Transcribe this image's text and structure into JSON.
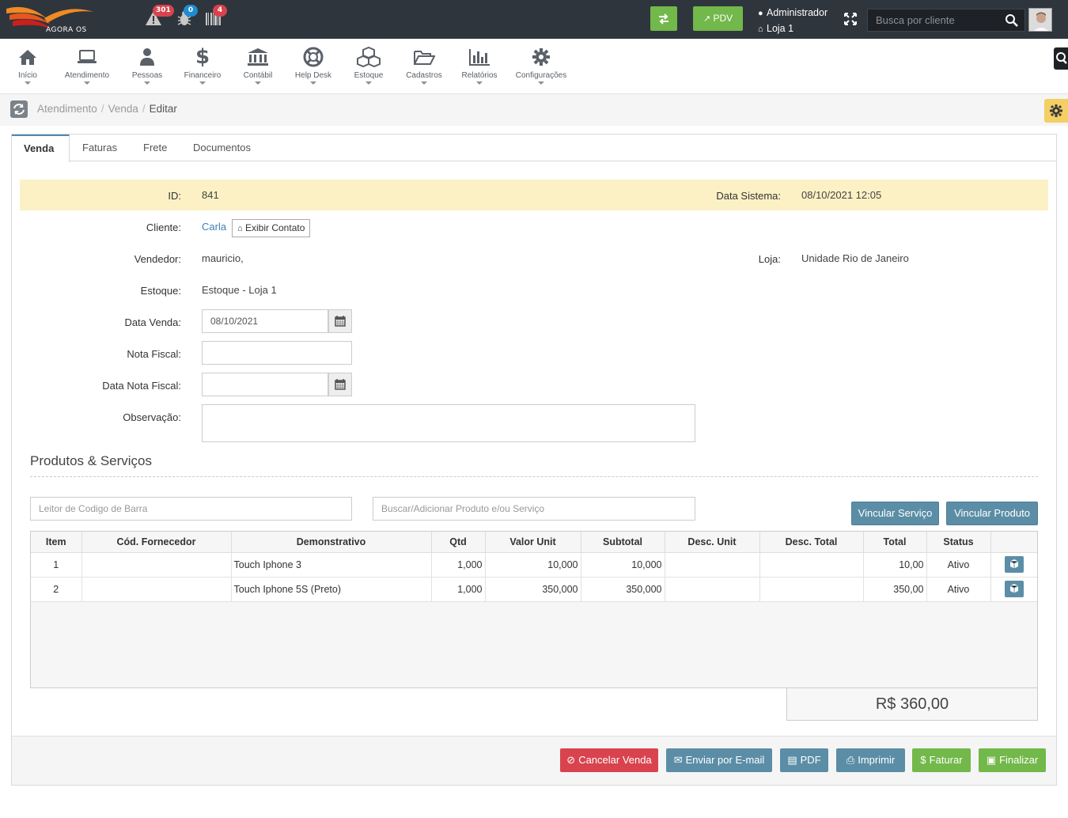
{
  "topbar": {
    "logo_text": "AGORA OS",
    "notifications": [
      {
        "icon": "warning-icon",
        "count": "301",
        "color": "#d9434e"
      },
      {
        "icon": "bug-icon",
        "count": "0",
        "color": "#1f8bd2"
      },
      {
        "icon": "barcode-icon",
        "count": "4",
        "color": "#d9434e"
      }
    ],
    "pdv_label": "PDV",
    "user_name": "Administrador",
    "store": "Loja 1",
    "search_placeholder": "Busca por cliente",
    "accent_green": "#72b84a"
  },
  "nav": [
    {
      "label": "Início",
      "icon": "home-icon"
    },
    {
      "label": "Atendimento",
      "icon": "laptop-icon"
    },
    {
      "label": "Pessoas",
      "icon": "user-icon"
    },
    {
      "label": "Financeiro",
      "icon": "dollar-icon"
    },
    {
      "label": "Contábil",
      "icon": "bank-icon"
    },
    {
      "label": "Help Desk",
      "icon": "lifebuoy-icon"
    },
    {
      "label": "Estoque",
      "icon": "cubes-icon"
    },
    {
      "label": "Cadastros",
      "icon": "folder-icon"
    },
    {
      "label": "Relatórios",
      "icon": "bar-chart-icon"
    },
    {
      "label": "Configurações",
      "icon": "gear-icon"
    }
  ],
  "breadcrumb": [
    "Atendimento",
    "Venda",
    "Editar"
  ],
  "tabs": [
    "Venda",
    "Faturas",
    "Frete",
    "Documentos"
  ],
  "form": {
    "id_label": "ID:",
    "id_value": "841",
    "data_sistema_label": "Data Sistema:",
    "data_sistema_value": "08/10/2021 12:05",
    "cliente_label": "Cliente:",
    "cliente_value": "Carla",
    "exibir_contato": "Exibir Contato",
    "vendedor_label": "Vendedor:",
    "vendedor_value": "mauricio,",
    "loja_label": "Loja:",
    "loja_value": "Unidade Rio de Janeiro",
    "estoque_label": "Estoque:",
    "estoque_value": "Estoque - Loja 1",
    "data_venda_label": "Data Venda:",
    "data_venda_value": "08/10/2021",
    "nota_fiscal_label": "Nota Fiscal:",
    "nota_fiscal_value": "",
    "data_nota_label": "Data Nota Fiscal:",
    "data_nota_value": "",
    "observacao_label": "Observação:",
    "observacao_value": ""
  },
  "products": {
    "title": "Produtos & Serviços",
    "barcode_placeholder": "Leitor de Codigo de Barra",
    "search_placeholder": "Buscar/Adicionar Produto e/ou Serviço",
    "vincular_servico": "Vincular Serviço",
    "vincular_produto": "Vincular Produto",
    "columns": [
      "Item",
      "Cód. Fornecedor",
      "Demonstrativo",
      "Qtd",
      "Valor Unit",
      "Subtotal",
      "Desc. Unit",
      "Desc. Total",
      "Total",
      "Status",
      ""
    ],
    "rows": [
      {
        "item": "1",
        "cod": "",
        "demo": "Touch Iphone 3",
        "qtd": "1,000",
        "valor": "10,000",
        "subtotal": "10,000",
        "desc_unit": "",
        "desc_total": "",
        "total": "10,00",
        "status": "Ativo"
      },
      {
        "item": "2",
        "cod": "",
        "demo": "Touch Iphone 5S (Preto)",
        "qtd": "1,000",
        "valor": "350,000",
        "subtotal": "350,000",
        "desc_unit": "",
        "desc_total": "",
        "total": "350,00",
        "status": "Ativo"
      }
    ],
    "grand_total": "R$ 360,00"
  },
  "footer": {
    "cancelar": "Cancelar Venda",
    "email": "Enviar por E-mail",
    "pdf": "PDF",
    "imprimir": "Imprimir",
    "faturar": "Faturar",
    "finalizar": "Finalizar",
    "colors": {
      "danger": "#d9434e",
      "info": "#5b8ea6",
      "success": "#72b84a"
    }
  }
}
